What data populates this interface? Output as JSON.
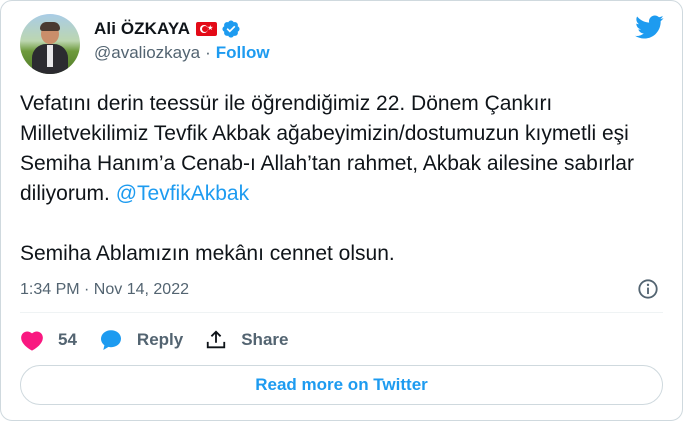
{
  "author": {
    "display_name": "Ali ÖZKAYA",
    "handle": "@avaliozkaya",
    "separator": "·",
    "follow_label": "Follow",
    "flag_icon": "turkey-flag-icon",
    "verified_icon": "verified-badge-icon"
  },
  "tweet": {
    "text_before_mention": "Vefatını derin teessür ile öğrendiğimiz 22. Dönem Çankırı Milletvekilimiz Tevfik Akbak ağabeyimizin/dostumuzun kıymetli eşi Semiha Hanım’a Cenab-ı Allah’tan rahmet, Akbak ailesine sabırlar diliyorum. ",
    "mention": "@TevfikAkbak",
    "text_after_mention": "\n\nSemiha Ablamızın mekânı cennet olsun."
  },
  "meta": {
    "timestamp": "1:34 PM · Nov 14, 2022"
  },
  "actions": {
    "like_count": "54",
    "reply_label": "Reply",
    "share_label": "Share"
  },
  "footer": {
    "read_more_label": "Read more on Twitter"
  },
  "colors": {
    "accent": "#1d9bf0",
    "like": "#f91880",
    "muted": "#536471",
    "text": "#0f1419",
    "border": "#cfd9de"
  }
}
